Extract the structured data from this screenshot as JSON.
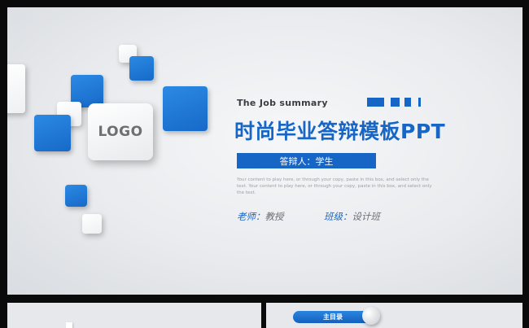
{
  "slide": {
    "logo_text": "LOGO",
    "subtitle_en": "The Job summary",
    "title": "时尚毕业答辩模板PPT",
    "presenter": "答辩人：学生",
    "description": "Your content to play here, or through your copy, paste in this box, and select only the text. Your content to play here, or through your copy, paste in this box, and select only the text.",
    "teacher_label": "老师：",
    "teacher_value": "教授",
    "class_label": "班级：",
    "class_value": "设计班"
  },
  "thumbnail_right": {
    "pill_label": "主目录"
  },
  "colors": {
    "accent_blue": "#1766c5",
    "background": "#e9ebee",
    "frame": "#0a0a0a"
  }
}
